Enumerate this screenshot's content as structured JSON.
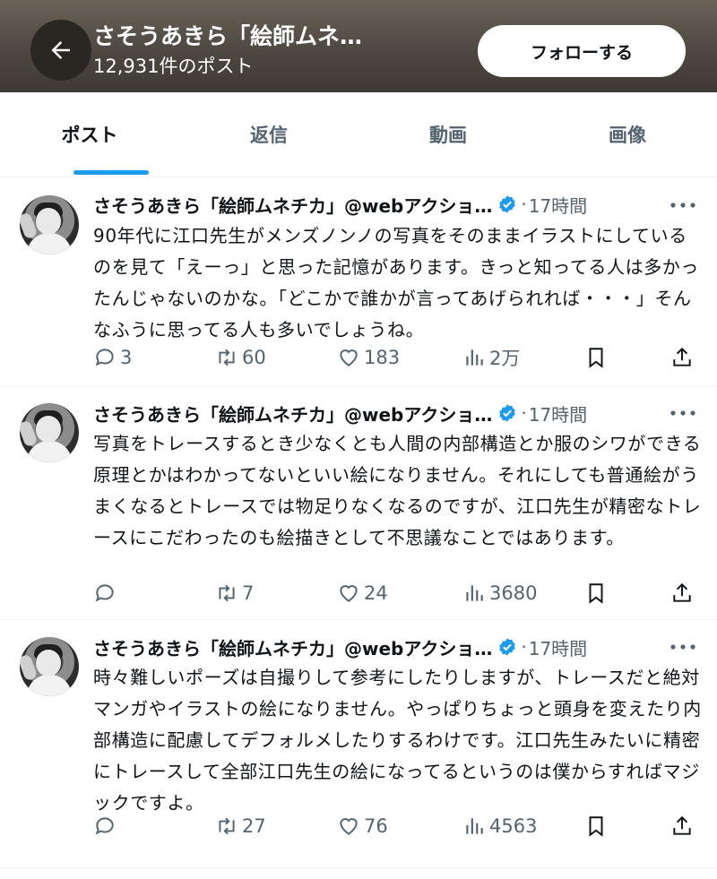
{
  "header": {
    "profile_name": "さそうあきら「絵師ムネ…",
    "post_count": "12,931件のポスト",
    "follow_label": "フォローする"
  },
  "tabs": [
    {
      "label": "ポスト",
      "active": true
    },
    {
      "label": "返信",
      "active": false
    },
    {
      "label": "動画",
      "active": false
    },
    {
      "label": "画像",
      "active": false
    }
  ],
  "posts": [
    {
      "author": "さそうあきら「絵師ムネチカ」@webアクショ…",
      "dot": "·",
      "time": "17時間",
      "text": "90年代に江口先生がメンズノンノの写真をそのままイラストにしているのを見て「えーっ」と思った記憶があります。きっと知ってる人は多かったんじゃないのかな。「どこかで誰かが言ってあげられれば・・・」そんなふうに思ってる人も多いでしょうね。",
      "replies": "3",
      "reposts": "60",
      "likes": "183",
      "views": "2万"
    },
    {
      "author": "さそうあきら「絵師ムネチカ」@webアクショ…",
      "dot": "·",
      "time": "17時間",
      "text": "写真をトレースするとき少なくとも人間の内部構造とか服のシワができる原理とかはわかってないといい絵になりません。それにしても普通絵がうまくなるとトレースでは物足りなくなるのですが、江口先生が精密なトレースにこだわったのも絵描きとして不思議なことではあります。",
      "replies": "",
      "reposts": "7",
      "likes": "24",
      "views": "3680"
    },
    {
      "author": "さそうあきら「絵師ムネチカ」@webアクショ…",
      "dot": "·",
      "time": "17時間",
      "text": "時々難しいポーズは自撮りして参考にしたりしますが、トレースだと絶対マンガやイラストの絵になりません。やっぱりちょっと頭身を変えたり内部構造に配慮してデフォルメしたりするわけです。江口先生みたいに精密にトレースして全部江口先生の絵になってるというのは僕からすればマジックですよ。",
      "replies": "",
      "reposts": "27",
      "likes": "76",
      "views": "4563"
    }
  ],
  "icons": {
    "back": "arrow-left-icon",
    "verified": "verified-badge-icon",
    "more": "more-horizontal-icon",
    "reply": "reply-icon",
    "repost": "repost-icon",
    "like": "heart-icon",
    "views": "views-chart-icon",
    "bookmark": "bookmark-icon",
    "share": "share-icon"
  },
  "colors": {
    "accent": "#1d9bf0",
    "muted": "#536471",
    "text": "#0f1419"
  }
}
